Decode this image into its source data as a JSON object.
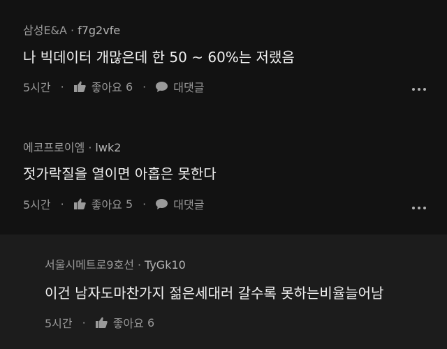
{
  "comments": [
    {
      "author": "삼성E&A",
      "separator": "·",
      "user_id": "f7g2vfe",
      "text": "나 빅데이터 개많은데 한 50 ~ 60%는 저랬음",
      "time": "5시간",
      "like_label": "좋아요",
      "like_count": "6",
      "reply_label": "대댓글"
    },
    {
      "author": "에코프로이엠",
      "separator": "·",
      "user_id": "lwk2",
      "text": "젓가락질을 열이면 아홉은 못한다",
      "time": "5시간",
      "like_label": "좋아요",
      "like_count": "5",
      "reply_label": "대댓글"
    }
  ],
  "reply": {
    "author": "서울시메트로9호선",
    "separator": "·",
    "user_id": "TyGk10",
    "text": "이건 남자도마찬가지 젊은세대러 갈수록 못하는비율늘어남",
    "time": "5시간",
    "like_label": "좋아요",
    "like_count": "6"
  },
  "icons": {
    "like": "thumbs-up-icon",
    "reply": "speech-bubble-icon",
    "more": "more-options-icon"
  },
  "colors": {
    "background": "#121212",
    "reply_background": "#1c1c1c",
    "text": "#f1f1f1",
    "meta": "#9a9a9a"
  }
}
